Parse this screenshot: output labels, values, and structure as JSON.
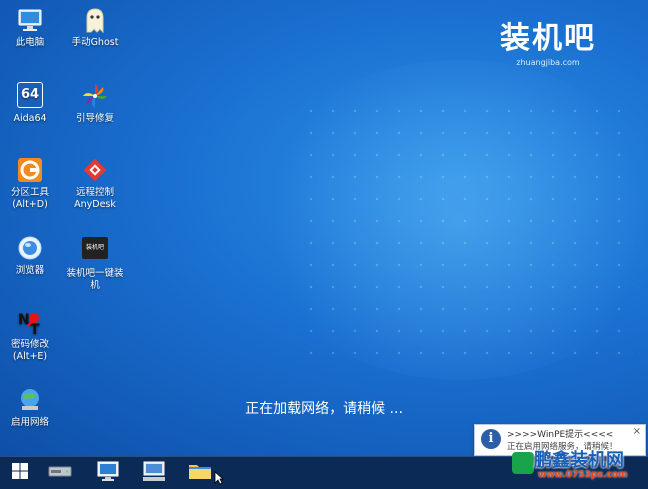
{
  "desktop": {
    "icons": [
      {
        "label": "此电脑",
        "icon": "computer-icon"
      },
      {
        "label": "手动Ghost",
        "icon": "ghost-icon"
      },
      {
        "label": "Aida64",
        "icon": "aida64-icon"
      },
      {
        "label": "引导修复",
        "icon": "pinwheel-icon"
      },
      {
        "label": "分区工具",
        "label2": "(Alt+D)",
        "icon": "diskgenius-icon"
      },
      {
        "label": "远程控制",
        "label2": "AnyDesk",
        "icon": "anydesk-icon"
      },
      {
        "label": "浏览器",
        "icon": "browser-icon"
      },
      {
        "label": "装机吧一键装",
        "label2": "机",
        "icon": "installer-icon"
      },
      {
        "label": "密码修改",
        "label2": "(Alt+E)",
        "icon": "password-icon"
      },
      {
        "label": "启用网络",
        "icon": "network-icon"
      }
    ],
    "aida_badge": "64",
    "installer_badge": "装机吧"
  },
  "brand": {
    "logo": "装机吧",
    "url": "zhuangjiba.com"
  },
  "status": "正在加载网络，请稍候 ...",
  "toast": {
    "title": ">>>>WinPE提示<<<<",
    "body": "正在启用网络服务，请稍候！",
    "close": "×",
    "info": "i"
  },
  "watermark": {
    "name": "鹏鑫装机网",
    "url": "www.0753px.com"
  },
  "taskbar": {
    "items": [
      "start-icon",
      "drive-icon",
      "computer-icon",
      "network-monitor-icon",
      "folder-icon"
    ]
  },
  "colors": {
    "desktop": "#1a6fd0",
    "taskbar": "#0b2a55",
    "accent": "#2a5ea8"
  }
}
